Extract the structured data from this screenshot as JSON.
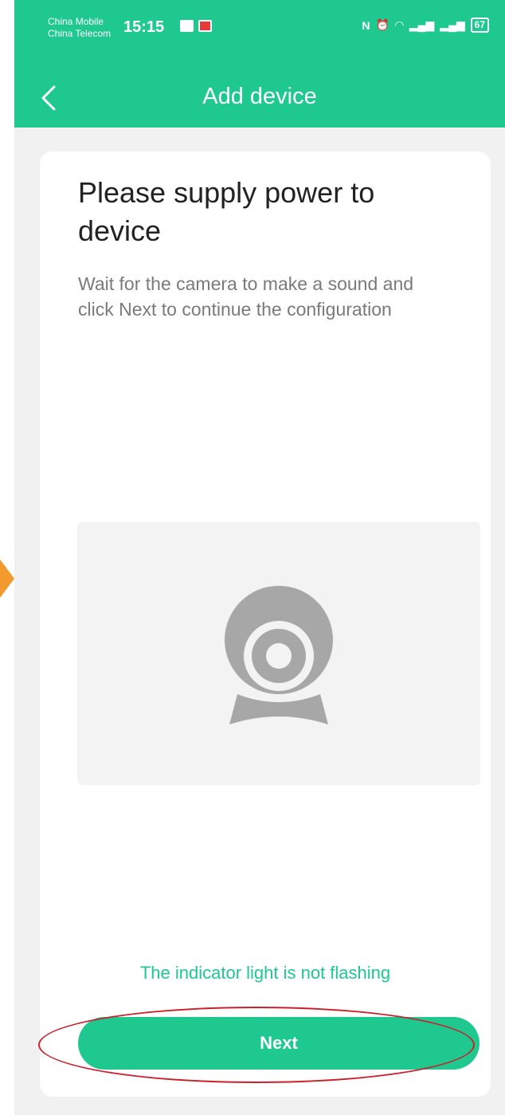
{
  "status_bar": {
    "carrier_1": "China Mobile",
    "carrier_2": "China Telecom",
    "time": "15:15",
    "battery": "67"
  },
  "nav": {
    "title": "Add device",
    "back_icon": "chevron-left-icon"
  },
  "content": {
    "heading": "Please supply power to device",
    "description": "Wait for the camera to make a sound and click Next to continue the configuration",
    "illustration_icon": "webcam-icon",
    "indicator_link": "The indicator light is not flashing",
    "next_label": "Next"
  },
  "colors": {
    "accent": "#1ec88f",
    "annotation_red": "#cc1f2b",
    "annotation_arrow": "#f39a2e"
  }
}
